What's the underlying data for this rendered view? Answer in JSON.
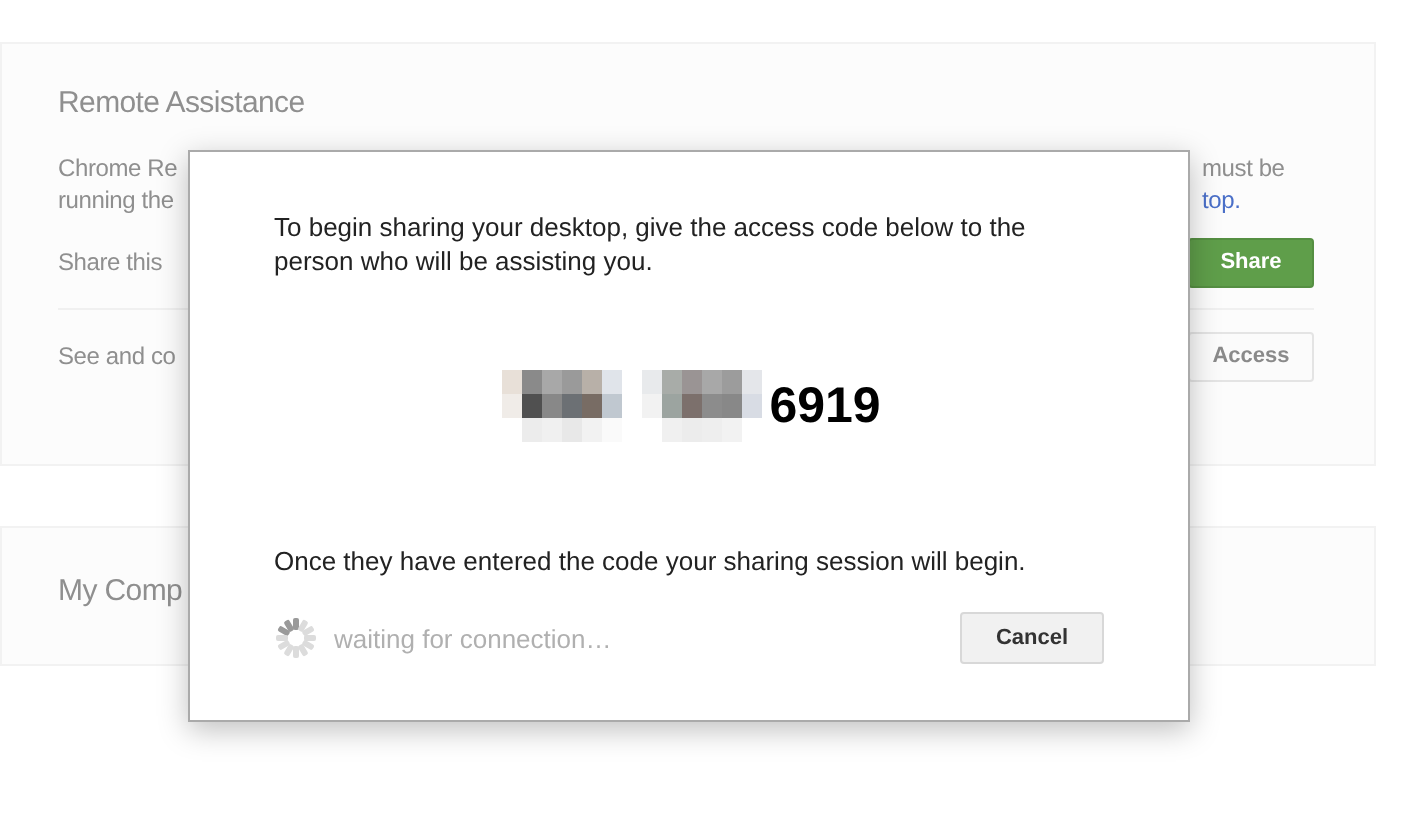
{
  "background": {
    "remote_assistance": {
      "title": "Remote Assistance",
      "description_left": [
        "Chrome Re",
        "running the"
      ],
      "description_right": [
        "must be",
        "top."
      ],
      "rows": [
        {
          "label": "Share this",
          "button": "Share",
          "kind": "primary"
        },
        {
          "label": "See and co",
          "button": "Access",
          "kind": "secondary"
        }
      ]
    },
    "my_computers": {
      "title": "My Comp"
    }
  },
  "dialog": {
    "instructions": "To begin sharing your desktop, give the access code below to the person who will be assisting you.",
    "access_code_visible": "6919",
    "note": "Once they have entered the code your sharing session will begin.",
    "status": "waiting for connection…",
    "cancel_button": "Cancel"
  }
}
